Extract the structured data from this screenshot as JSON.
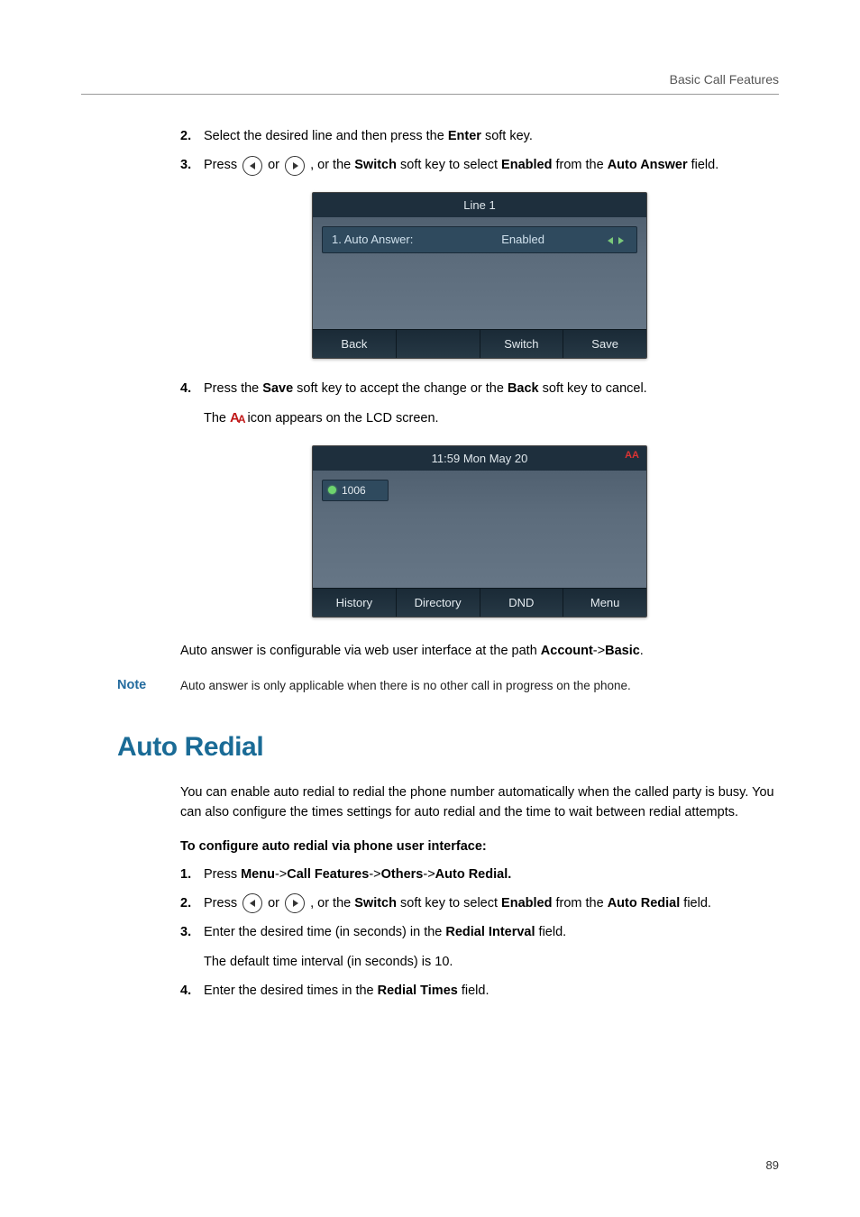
{
  "header": {
    "title": "Basic Call Features"
  },
  "steps_a": {
    "s2": {
      "num": "2.",
      "text_before": "Select the desired line and then press the ",
      "enter": "Enter",
      "text_after": " soft key."
    },
    "s3": {
      "num": "3.",
      "press": "Press ",
      "or": " or ",
      "after_arrows": " , or the ",
      "switch": "Switch",
      "mid": " soft key to select ",
      "enabled": "Enabled",
      "from": " from the ",
      "auto_answer": "Auto Answer",
      "tail": " field."
    }
  },
  "lcd1": {
    "title": "Line 1",
    "field_label": "1. Auto Answer:",
    "field_value": "Enabled",
    "sk_back": "Back",
    "sk_switch": "Switch",
    "sk_save": "Save"
  },
  "step4": {
    "num": "4.",
    "t1": "Press the ",
    "save": "Save",
    "t2": " soft key to accept the change or the ",
    "back": "Back",
    "t3": " soft key to cancel."
  },
  "step4_sub": {
    "t1": "The ",
    "t2": " icon appears on the LCD screen."
  },
  "lcd2": {
    "time": "11:59 Mon May 20",
    "ext": "1006",
    "sk_history": "History",
    "sk_directory": "Directory",
    "sk_dnd": "DND",
    "sk_menu": "Menu"
  },
  "para_web": {
    "t1": "Auto answer is configurable via web user interface at the path ",
    "account": "Account",
    "arrow": "->",
    "basic": "Basic",
    "dot": "."
  },
  "note": {
    "label": "Note",
    "text": "Auto answer is only applicable when there is no other call in progress on the phone."
  },
  "section": {
    "heading": "Auto Redial"
  },
  "redial_intro": "You can enable auto redial to redial the phone number automatically when the called party is busy. You can also configure the times settings for auto redial and the time to wait between redial attempts.",
  "redial_subhead": "To configure auto redial via phone user interface:",
  "steps_b": {
    "s1": {
      "num": "1.",
      "press": "Press ",
      "menu": "Menu",
      "arrow": "->",
      "call_features": "Call Features",
      "others": "Others",
      "auto_redial": "Auto Redial."
    },
    "s2": {
      "num": "2.",
      "press": "Press ",
      "or": " or ",
      "after": " , or the ",
      "switch": "Switch",
      "mid": " soft key to select ",
      "enabled": "Enabled",
      "from": " from the ",
      "auto_redial": "Auto Redial",
      "tail": " field."
    },
    "s3": {
      "num": "3.",
      "t1": "Enter the desired time (in seconds) in the ",
      "redial_interval": "Redial Interval",
      "t2": " field.",
      "sub": "The default time interval (in seconds) is 10."
    },
    "s4": {
      "num": "4.",
      "t1": "Enter the desired times in the ",
      "redial_times": "Redial Times",
      "t2": " field."
    }
  },
  "page_number": "89"
}
